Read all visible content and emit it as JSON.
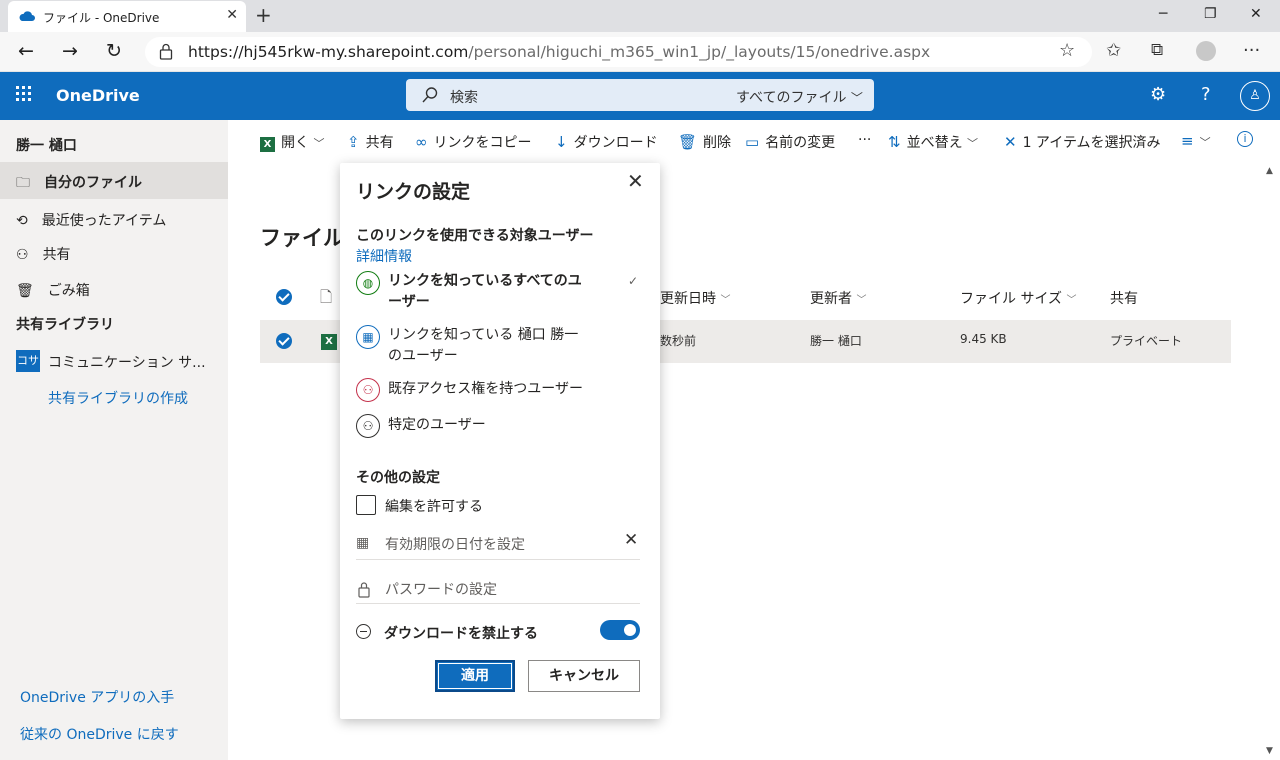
{
  "browser": {
    "tab_title": "ファイル - OneDrive",
    "url_host": "https://hj545rkw-my.sharepoint.com",
    "url_path": "/personal/higuchi_m365_win1_jp/_layouts/15/onedrive.aspx"
  },
  "header": {
    "brand": "OneDrive",
    "search_placeholder": "検索",
    "search_scope": "すべてのファイル"
  },
  "sidebar": {
    "user": "勝一 樋口",
    "items": [
      "自分のファイル",
      "最近使ったアイテム",
      "共有",
      "ごみ箱"
    ],
    "shared_libraries_header": "共有ライブラリ",
    "library_badge": "コサ",
    "library_name": "コミュニケーション サ...",
    "create_library": "共有ライブラリの作成",
    "get_app": "OneDrive アプリの入手",
    "classic": "従来の OneDrive に戻す"
  },
  "commandbar": {
    "open": "開く",
    "share": "共有",
    "copy_link": "リンクをコピー",
    "download": "ダウンロード",
    "delete": "削除",
    "rename": "名前の変更",
    "more": "···",
    "sort": "並べ替え",
    "selected": "1 アイテムを選択済み"
  },
  "content": {
    "title": "ファイル",
    "columns": {
      "modified": "更新日時",
      "modified_by": "更新者",
      "size": "ファイル サイズ",
      "sharing": "共有"
    },
    "row": {
      "modified": "数秒前",
      "modified_by": "勝一 樋口",
      "size": "9.45 KB",
      "sharing": "プライベート"
    }
  },
  "panel": {
    "title": "リンクの設定",
    "audience_header": "このリンクを使用できる対象ユーザー",
    "learn_more": "詳細情報",
    "options": [
      {
        "label_l1": "リンクを知っているすべてのユ",
        "label_l2": "ーザー"
      },
      {
        "label_l1": "リンクを知っている 樋口 勝一",
        "label_l2": "のユーザー"
      },
      {
        "label_l1": "既存アクセス権を持つユーザー",
        "label_l2": ""
      },
      {
        "label_l1": "特定のユーザー",
        "label_l2": ""
      }
    ],
    "other_settings": "その他の設定",
    "allow_edit": "編集を許可する",
    "expiry_placeholder": "有効期限の日付を設定",
    "password_placeholder": "パスワードの設定",
    "block_download": "ダウンロードを禁止する",
    "block_download_on": true,
    "apply": "適用",
    "cancel": "キャンセル"
  },
  "colors": {
    "accent": "#0f6cbd",
    "selected_row": "#edebe9",
    "nav_bg": "#f3f2f1"
  }
}
